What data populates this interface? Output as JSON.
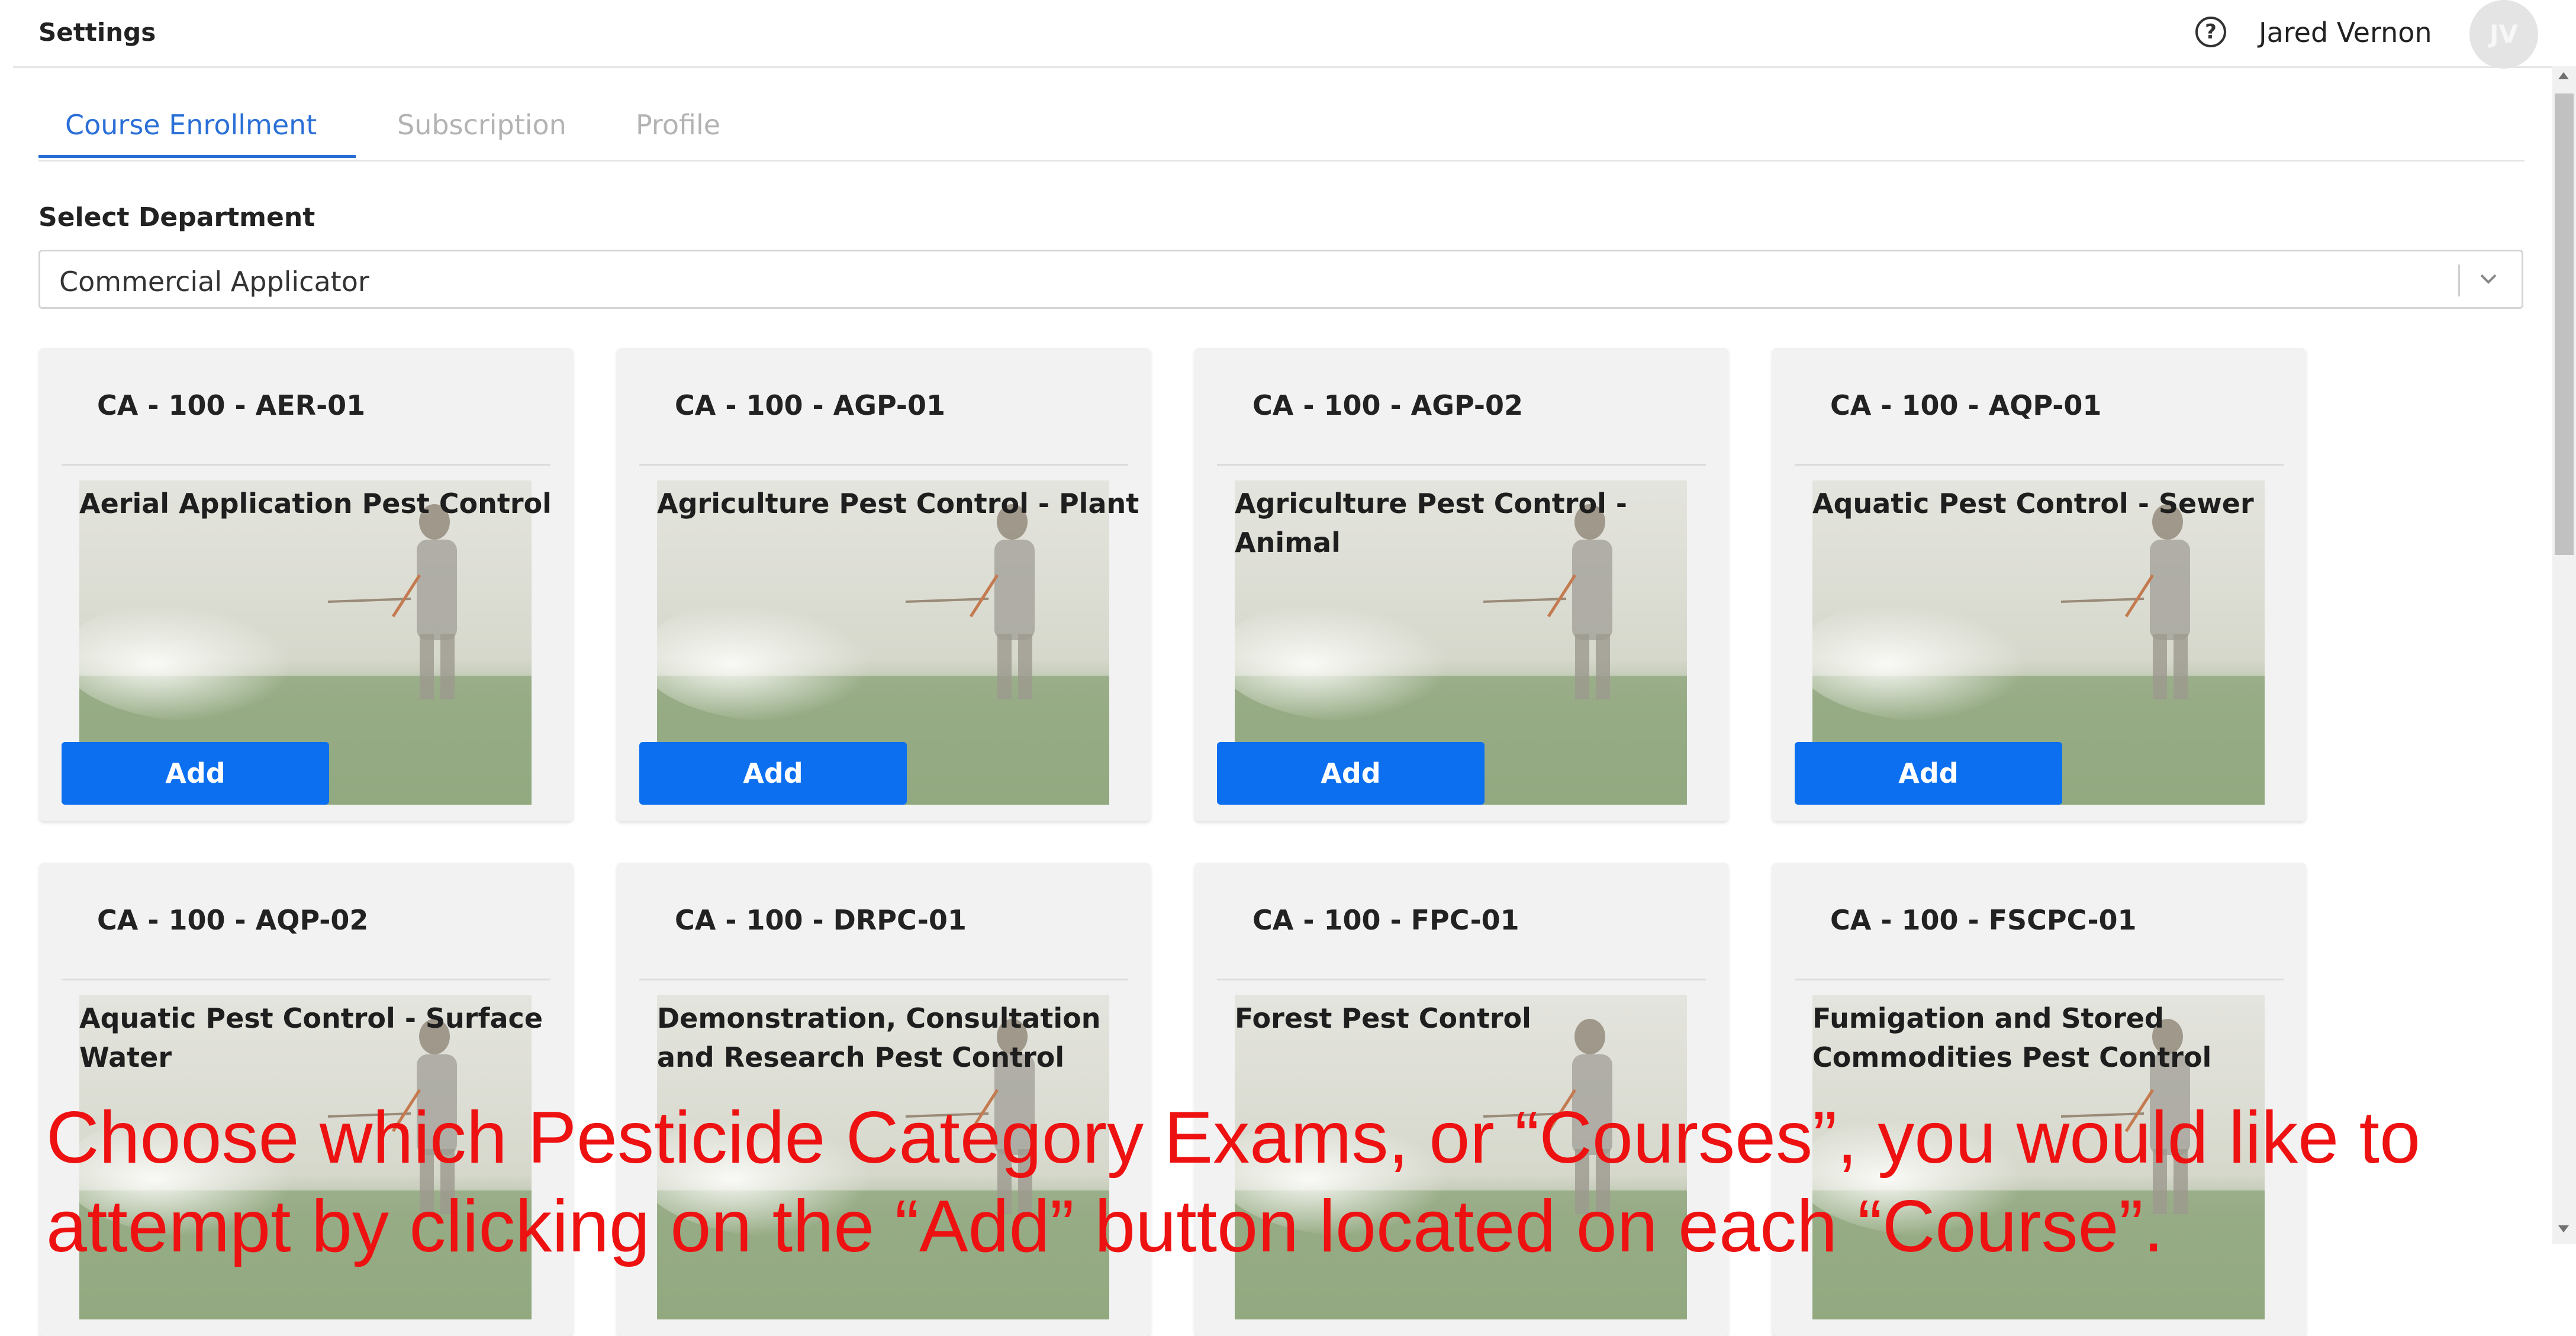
{
  "header": {
    "title": "Settings",
    "help_icon": "help-circle-icon",
    "user_name": "Jared Vernon",
    "avatar_initials": "JV"
  },
  "tabs": [
    {
      "label": "Course Enrollment",
      "active": true
    },
    {
      "label": "Subscription",
      "active": false
    },
    {
      "label": "Profile",
      "active": false
    }
  ],
  "department": {
    "label": "Select Department",
    "selected": "Commercial Applicator"
  },
  "courses": [
    {
      "code": "CA - 100 - AER-01",
      "title": "Aerial Application Pest Control",
      "button": "Add"
    },
    {
      "code": "CA - 100 - AGP-01",
      "title": "Agriculture Pest Control - Plant",
      "button": "Add"
    },
    {
      "code": "CA - 100 - AGP-02",
      "title": "Agriculture Pest Control - Animal",
      "button": "Add"
    },
    {
      "code": "CA - 100 - AQP-01",
      "title": "Aquatic Pest Control - Sewer",
      "button": "Add"
    },
    {
      "code": "CA - 100 - AQP-02",
      "title": "Aquatic Pest Control - Surface Water"
    },
    {
      "code": "CA - 100 - DRPC-01",
      "title": "Demonstration, Consultation and Research Pest Control"
    },
    {
      "code": "CA - 100 - FPC-01",
      "title": "Forest Pest Control"
    },
    {
      "code": "CA - 100 - FSCPC-01",
      "title": "Fumigation and Stored Commodities Pest Control"
    }
  ],
  "caption": "Choose which Pesticide Category Exams, or “Courses”, you would like to\nattempt by clicking on the “Add” button located on each “Course”.",
  "colors": {
    "accent": "#2a6fd6",
    "button": "#0b6ff0",
    "caption": "#ee1111"
  }
}
